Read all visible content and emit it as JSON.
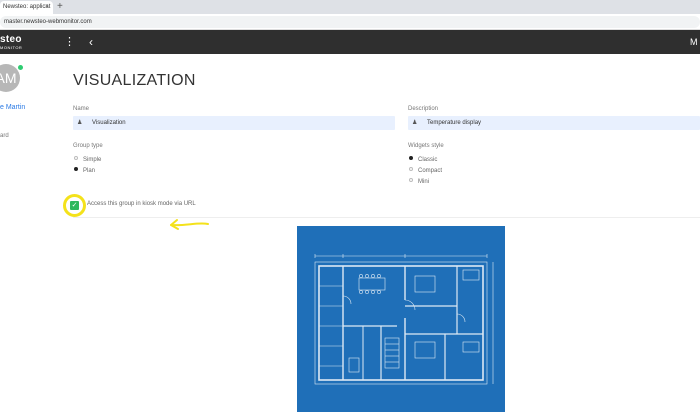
{
  "browser": {
    "tab_title": "Newsteo: applicat",
    "tab_close": "×",
    "new_tab": "+",
    "url": "master.newsteo-webmonitor.com"
  },
  "header": {
    "logo_main": "steo",
    "logo_sub": "MONITOR",
    "menu_glyph": "⋮",
    "back_glyph": "‹",
    "right_text": "M"
  },
  "sidebar": {
    "avatar_initials": "AM",
    "user_name": "e Martin",
    "nav_item": "ard"
  },
  "page": {
    "title": "VISUALIZATION"
  },
  "form": {
    "field_icon": "♟",
    "name_label": "Name",
    "name_value": "Visualization",
    "description_label": "Description",
    "description_value": "Temperature display",
    "group_type_label": "Group type",
    "group_type_options": [
      "Simple",
      "Plan"
    ],
    "group_type_selected": "Plan",
    "widgets_style_label": "Widgets style",
    "widgets_style_options": [
      "Classic",
      "Compact",
      "Mini"
    ],
    "widgets_style_selected": "Classic",
    "kiosk_check_glyph": "✓",
    "kiosk_label": "Access this group in kiosk mode via URL",
    "kiosk_checked": true
  },
  "colors": {
    "header_bg": "#2f2f2f",
    "field_bg": "#e8f0fe",
    "accent_link": "#2c7be5",
    "checkbox_green": "#2eb85c",
    "annotation_yellow": "#f4e21b",
    "plan_blue": "#1f6fb8"
  }
}
